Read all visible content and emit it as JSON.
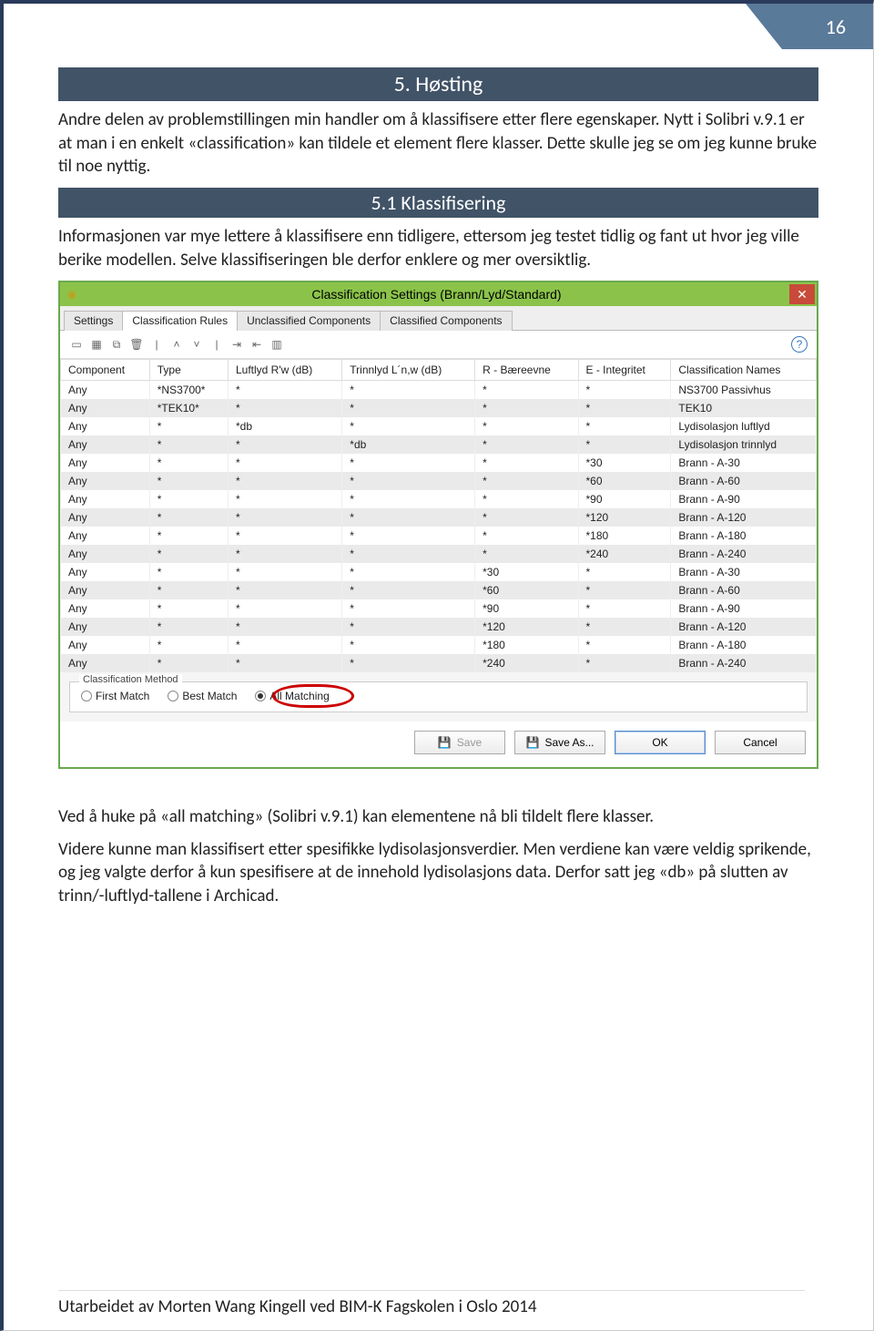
{
  "page": {
    "number": "16"
  },
  "section": {
    "title": "5. Høsting"
  },
  "para1": "Andre delen av problemstillingen min handler om å klassifisere etter flere egenskaper. Nytt i Solibri v.9.1 er at man i en enkelt «classification» kan tildele et element flere klasser. Dette skulle jeg se om jeg kunne bruke til noe nyttig.",
  "subsection": {
    "title": "5.1 Klassifisering"
  },
  "para2": "Informasjonen var mye lettere å klassifisere enn tidligere, ettersom jeg testet tidlig og fant ut hvor jeg ville berike modellen. Selve klassifiseringen ble derfor enklere og mer oversiktlig.",
  "dialog": {
    "title": "Classification Settings (Brann/Lyd/Standard)",
    "tabs": [
      "Settings",
      "Classification Rules",
      "Unclassified Components",
      "Classified Components"
    ],
    "active_tab": 1,
    "columns": [
      "Component",
      "Type",
      "Luftlyd R'w (dB)",
      "Trinnlyd L´n,w (dB)",
      "R - Bæreevne",
      "E - Integritet",
      "Classification Names"
    ],
    "rows": [
      [
        "Any",
        "*NS3700*",
        "*",
        "*",
        "*",
        "*",
        "NS3700 Passivhus"
      ],
      [
        "Any",
        "*TEK10*",
        "*",
        "*",
        "*",
        "*",
        "TEK10"
      ],
      [
        "Any",
        "*",
        "*db",
        "*",
        "*",
        "*",
        "Lydisolasjon luftlyd"
      ],
      [
        "Any",
        "*",
        "*",
        "*db",
        "*",
        "*",
        "Lydisolasjon trinnlyd"
      ],
      [
        "Any",
        "*",
        "*",
        "*",
        "*",
        "*30",
        "Brann - A-30"
      ],
      [
        "Any",
        "*",
        "*",
        "*",
        "*",
        "*60",
        "Brann - A-60"
      ],
      [
        "Any",
        "*",
        "*",
        "*",
        "*",
        "*90",
        "Brann - A-90"
      ],
      [
        "Any",
        "*",
        "*",
        "*",
        "*",
        "*120",
        "Brann - A-120"
      ],
      [
        "Any",
        "*",
        "*",
        "*",
        "*",
        "*180",
        "Brann - A-180"
      ],
      [
        "Any",
        "*",
        "*",
        "*",
        "*",
        "*240",
        "Brann - A-240"
      ],
      [
        "Any",
        "*",
        "*",
        "*",
        "*30",
        "*",
        "Brann - A-30"
      ],
      [
        "Any",
        "*",
        "*",
        "*",
        "*60",
        "*",
        "Brann - A-60"
      ],
      [
        "Any",
        "*",
        "*",
        "*",
        "*90",
        "*",
        "Brann - A-90"
      ],
      [
        "Any",
        "*",
        "*",
        "*",
        "*120",
        "*",
        "Brann - A-120"
      ],
      [
        "Any",
        "*",
        "*",
        "*",
        "*180",
        "*",
        "Brann - A-180"
      ],
      [
        "Any",
        "*",
        "*",
        "*",
        "*240",
        "*",
        "Brann - A-240"
      ]
    ],
    "method": {
      "legend": "Classification Method",
      "options": [
        "First Match",
        "Best Match",
        "All Matching"
      ],
      "selected": 2
    },
    "buttons": {
      "save": "Save",
      "save_as": "Save As...",
      "ok": "OK",
      "cancel": "Cancel"
    }
  },
  "para3": "Ved å huke på «all matching» (Solibri v.9.1) kan elementene nå bli tildelt flere klasser.",
  "para4": "Videre kunne man klassifisert etter spesifikke lydisolasjonsverdier. Men verdiene kan være veldig sprikende, og jeg valgte derfor å kun spesifisere at de innehold lydisolasjons data. Derfor satt jeg «db» på slutten av trinn/-luftlyd-tallene i Archicad.",
  "footer": "Utarbeidet av Morten Wang Kingell ved BIM-K Fagskolen i Oslo 2014"
}
